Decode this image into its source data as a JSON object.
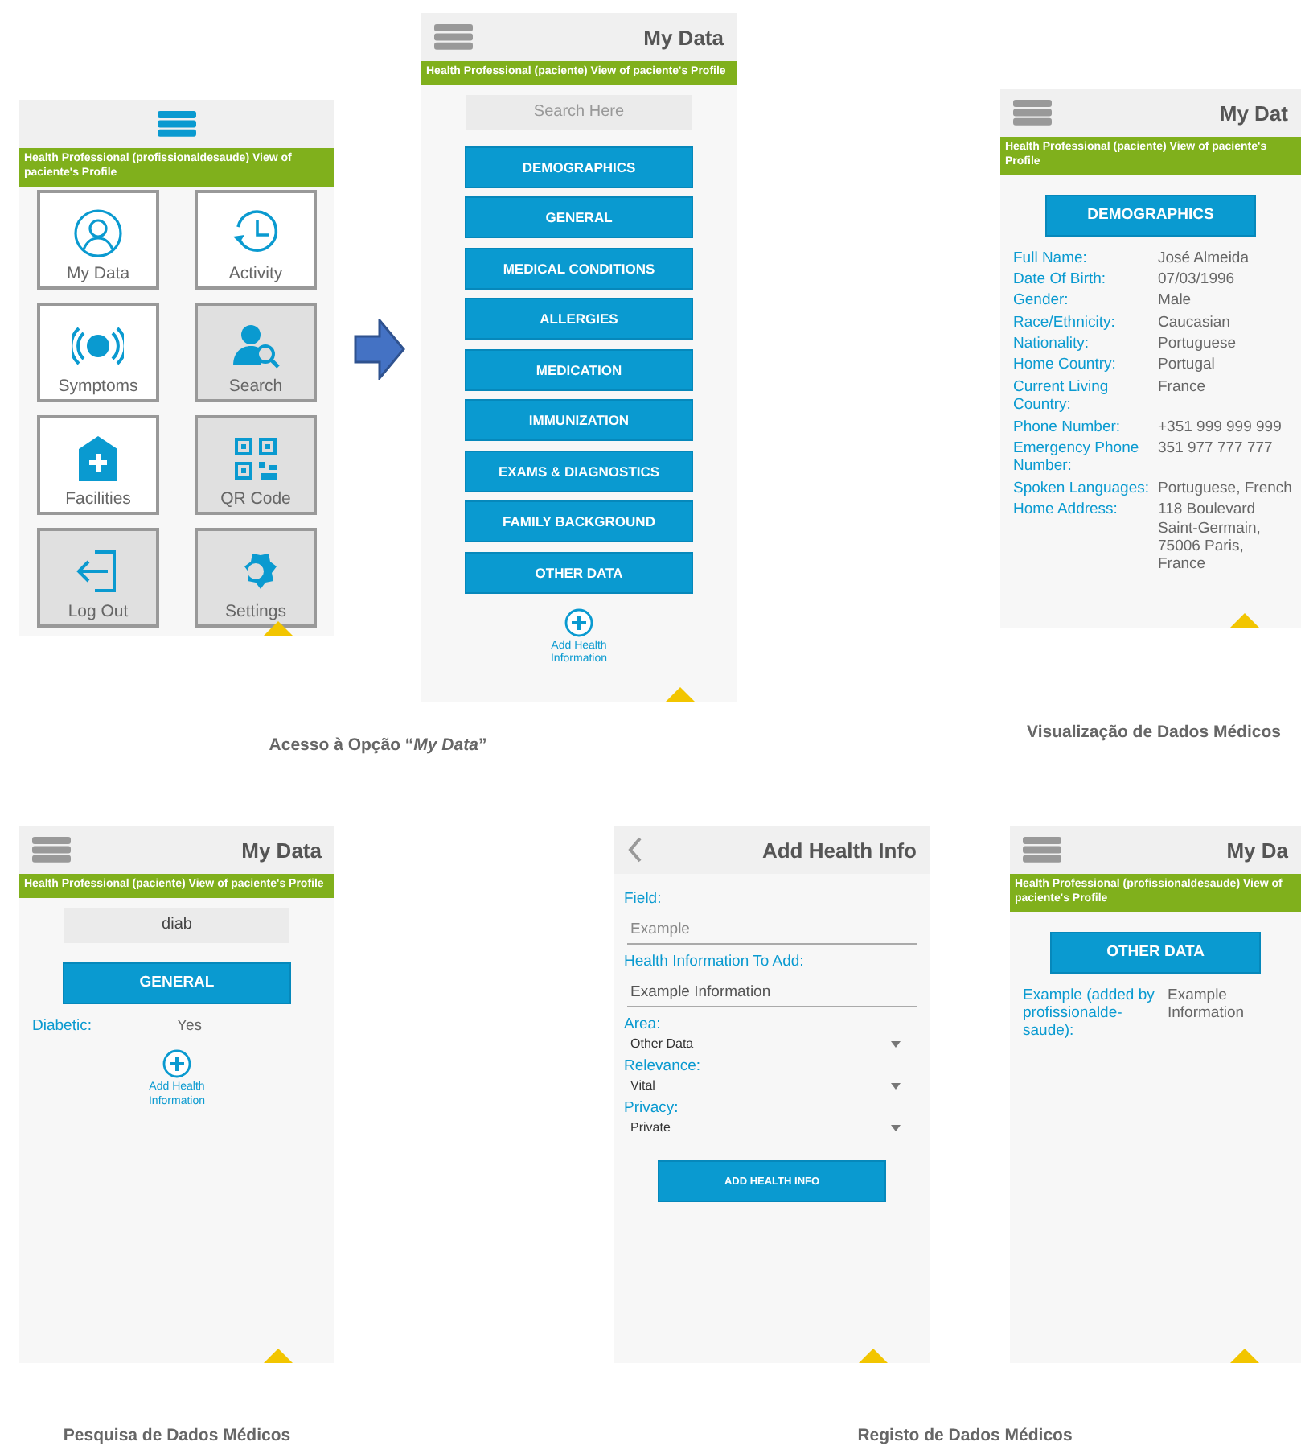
{
  "screens": [
    {
      "kind": "menu",
      "banner": "Health Professional (profissionaldesaude) View of paciente's Profile",
      "tiles": [
        {
          "label": "My Data",
          "disabled": false
        },
        {
          "label": "Activity",
          "disabled": false
        },
        {
          "label": "Symptoms",
          "disabled": false
        },
        {
          "label": "Search",
          "disabled": true
        },
        {
          "label": "Facilities",
          "disabled": false
        },
        {
          "label": "QR Code",
          "disabled": true
        },
        {
          "label": "Log Out",
          "disabled": true
        },
        {
          "label": "Settings",
          "disabled": true
        }
      ]
    },
    {
      "kind": "categories",
      "title": "My Data",
      "banner": "Health Professional (paciente) View of paciente's Profile",
      "search": {
        "placeholder": "Search Here"
      },
      "categories": [
        "DEMOGRAPHICS",
        "GENERAL",
        "MEDICAL CONDITIONS",
        "ALLERGIES",
        "MEDICATION",
        "IMMUNIZATION",
        "EXAMS & DIAGNOSTICS",
        "FAMILY BACKGROUND",
        "OTHER DATA"
      ],
      "add_label": "Add Health Information"
    },
    {
      "kind": "details",
      "title": "My Dat",
      "banner": "Health Professional (paciente) View of paciente's Profile",
      "section": "DEMOGRAPHICS",
      "fields": [
        {
          "label": "Full Name:",
          "value": "José Almeida"
        },
        {
          "label": "Date Of Birth:",
          "value": "07/03/1996"
        },
        {
          "label": "Gender:",
          "value": "Male"
        },
        {
          "label": "Race/Ethnicity:",
          "value": "Caucasian"
        },
        {
          "label": "Nationality:",
          "value": "Portuguese"
        },
        {
          "label": "Home Country:",
          "value": "Portugal"
        },
        {
          "label": "Current Living Country:",
          "value": "France"
        },
        {
          "label": "Phone Number:",
          "value": "+351 999 999 999"
        },
        {
          "label": "Emergency Phone Number:",
          "value": "351 977 777 777"
        },
        {
          "label": "Spoken Languages:",
          "value": "Portuguese, French"
        },
        {
          "label": "Home Address:",
          "value": "118 Boulevard Saint-Germain, 75006 Paris, France"
        }
      ]
    },
    {
      "kind": "search_result",
      "title": "My Data",
      "banner": "Health Professional (paciente) View of paciente's Profile",
      "search": {
        "value": "diab"
      },
      "section": "GENERAL",
      "fields": [
        {
          "label": "Diabetic:",
          "value": "Yes"
        }
      ],
      "add_label": "Add Health Information"
    },
    {
      "kind": "form",
      "title": "Add Health Info",
      "inputs": [
        {
          "label": "Field:",
          "placeholder": "Example"
        },
        {
          "label": "Health Information To Add:",
          "value": "Example Information"
        }
      ],
      "selects": [
        {
          "label": "Area:",
          "value": "Other Data"
        },
        {
          "label": "Relevance:",
          "value": "Vital"
        },
        {
          "label": "Privacy:",
          "value": "Private"
        }
      ],
      "submit": "ADD HEALTH INFO"
    },
    {
      "kind": "details",
      "title": "My Da",
      "banner": "Health Professional (profissionaldesaude) View of paciente's Profile",
      "section": "OTHER DATA",
      "fields": [
        {
          "label": "Example (added by profissionalde-saude):",
          "value": "Example Information"
        }
      ]
    }
  ],
  "captions": [
    "Acesso à Opção “*My Data*”",
    "Visualização de Dados Médicos",
    "Pesquisa de Dados Médicos",
    "Registo de Dados Médicos"
  ]
}
